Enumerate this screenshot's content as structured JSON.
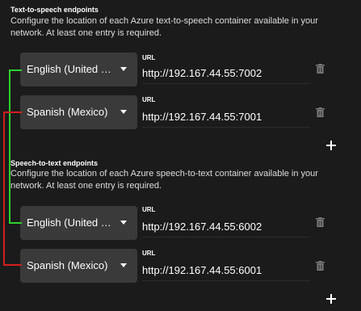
{
  "tts": {
    "title": "Text-to-speech endpoints",
    "description": "Configure the location of each Azure text-to-speech container available in your network. At least one entry is required.",
    "entries": [
      {
        "language": "English (United States)",
        "url_label": "URL",
        "url": "http://192.167.44.55:7002"
      },
      {
        "language": "Spanish (Mexico)",
        "url_label": "URL",
        "url": "http://192.167.44.55:7001"
      }
    ]
  },
  "stt": {
    "title": "Speech-to-text endpoints",
    "description": "Configure the location of each Azure speech-to-text container available in your network. At least one entry is required.",
    "entries": [
      {
        "language": "English (United States)",
        "url_label": "URL",
        "url": "http://192.167.44.55:6002"
      },
      {
        "language": "Spanish (Mexico)",
        "url_label": "URL",
        "url": "http://192.167.44.55:6001"
      }
    ]
  },
  "colors": {
    "background": "#1b1b1b",
    "select_bg": "#3a3a3a",
    "english_link": "#2ed12e",
    "spanish_link": "#d61d1d"
  },
  "icons": {
    "delete": "trash-icon",
    "add": "plus-icon",
    "dropdown": "chevron-down-icon"
  }
}
